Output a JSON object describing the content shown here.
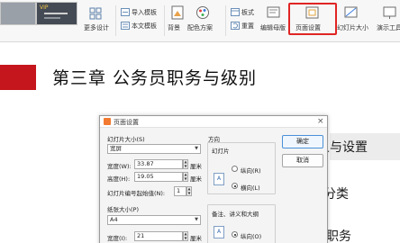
{
  "ribbon": {
    "templates": {
      "badge": "VIP",
      "more_design": "更多设计"
    },
    "import_template": "导入模板",
    "text_template": "本文模板",
    "background": "背景",
    "color_scheme": "配色方案",
    "layout": "板式",
    "reset": "重置",
    "edit_master": "编辑母版",
    "page_setup": "页面设置",
    "slide_size": "幻灯片大小",
    "presenter_tools": "演示工具"
  },
  "slide": {
    "chapter_title": "第三章  公务员职务与级别",
    "bg_line1": "含义与设置",
    "bg_line2": "位分类",
    "bg_line3": "职务"
  },
  "dialog": {
    "title": "页面设置",
    "close": "×",
    "slide_size_label": "幻灯片大小(S)",
    "slide_size_value": "宽屏",
    "width_label": "宽度(W):",
    "width_value": "33.87",
    "height_label": "高度(H):",
    "height_value": "19.05",
    "unit": "厘米",
    "start_number_label": "幻灯片编号起始值(N):",
    "start_number_value": "1",
    "paper_size_label": "纸张大小(P)",
    "paper_size_value": "A4",
    "paper_width_label": "宽度(I):",
    "paper_width_value": "21",
    "orientation_label": "方向",
    "slides_label": "幻灯片",
    "portrait_label": "纵向(R)",
    "landscape_label": "横向(L)",
    "notes_label": "备注、讲义和大纲",
    "notes_portrait_label": "纵向(O)",
    "ok": "确定",
    "cancel": "取消"
  },
  "colors": {
    "accent_red": "#c4161c",
    "highlight_box": "#e02424",
    "dialog_primary_border": "#4a90d9"
  }
}
